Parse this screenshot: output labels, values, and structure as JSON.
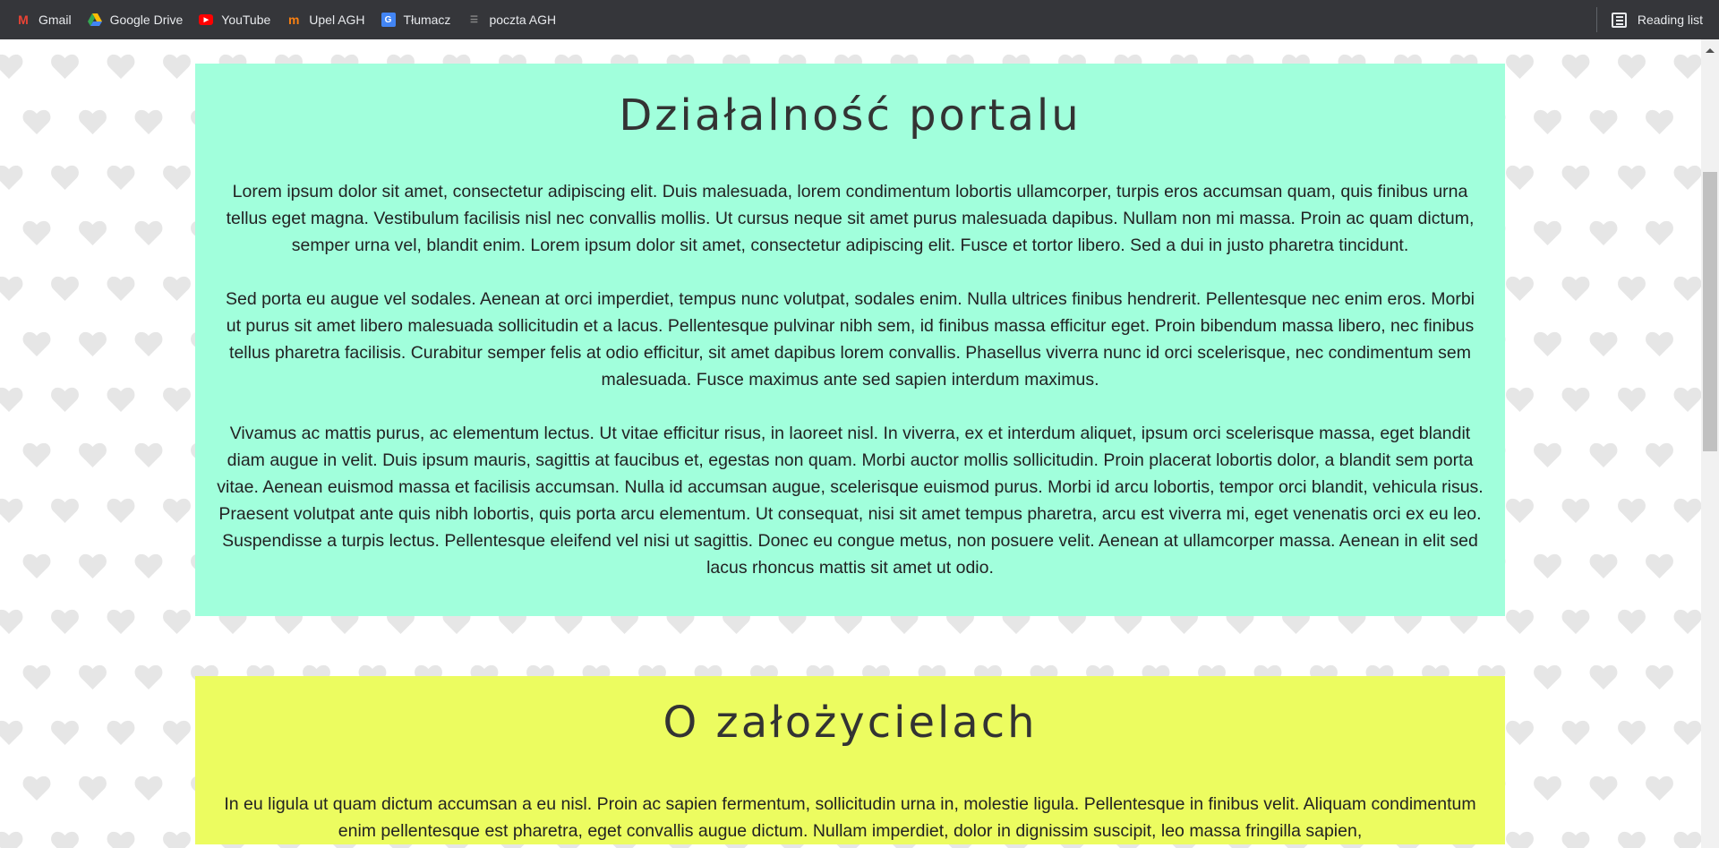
{
  "bookmarks": [
    {
      "label": "Gmail",
      "icon": "gmail-icon",
      "color": "#ea4335"
    },
    {
      "label": "Google Drive",
      "icon": "google-drive-icon",
      "color": "#34a853"
    },
    {
      "label": "YouTube",
      "icon": "youtube-icon",
      "color": "#ff0000"
    },
    {
      "label": "Upel AGH",
      "icon": "moodle-icon",
      "color": "#f98012"
    },
    {
      "label": "Tłumacz",
      "icon": "google-translate-icon",
      "color": "#4285f4"
    },
    {
      "label": "poczta AGH",
      "icon": "mail-icon",
      "color": "#444444"
    }
  ],
  "reading_list": "Reading list",
  "sections": [
    {
      "title": "Działalność portalu",
      "bg": "#a1ffdc",
      "paragraphs": [
        "Lorem ipsum dolor sit amet, consectetur adipiscing elit. Duis malesuada, lorem condimentum lobortis ullamcorper, turpis eros accumsan quam, quis finibus urna tellus eget magna. Vestibulum facilisis nisl nec convallis mollis. Ut cursus neque sit amet purus malesuada dapibus. Nullam non mi massa. Proin ac quam dictum, semper urna vel, blandit enim. Lorem ipsum dolor sit amet, consectetur adipiscing elit. Fusce et tortor libero. Sed a dui in justo pharetra tincidunt.",
        "Sed porta eu augue vel sodales. Aenean at orci imperdiet, tempus nunc volutpat, sodales enim. Nulla ultrices finibus hendrerit. Pellentesque nec enim eros. Morbi ut purus sit amet libero malesuada sollicitudin et a lacus. Pellentesque pulvinar nibh sem, id finibus massa efficitur eget. Proin bibendum massa libero, nec finibus tellus pharetra facilisis. Curabitur semper felis at odio efficitur, sit amet dapibus lorem convallis. Phasellus viverra nunc id orci scelerisque, nec condimentum sem malesuada. Fusce maximus ante sed sapien interdum maximus.",
        "Vivamus ac mattis purus, ac elementum lectus. Ut vitae efficitur risus, in laoreet nisl. In viverra, ex et interdum aliquet, ipsum orci scelerisque massa, eget blandit diam augue in velit. Duis ipsum mauris, sagittis at faucibus et, egestas non quam. Morbi auctor mollis sollicitudin. Proin placerat lobortis dolor, a blandit sem porta vitae. Aenean euismod massa et facilisis accumsan. Nulla id accumsan augue, scelerisque euismod purus. Morbi id arcu lobortis, tempor orci blandit, vehicula risus. Praesent volutpat ante quis nibh lobortis, quis porta arcu elementum. Ut consequat, nisi sit amet tempus pharetra, arcu est viverra mi, eget venenatis orci ex eu leo. Suspendisse a turpis lectus. Pellentesque eleifend vel nisi ut sagittis. Donec eu congue metus, non posuere velit. Aenean at ullamcorper massa. Aenean in elit sed lacus rhoncus mattis sit amet ut odio."
      ]
    },
    {
      "title": "O założycielach",
      "bg": "#ecfc60",
      "paragraphs": [
        "In eu ligula ut quam dictum accumsan a eu nisl. Proin ac sapien fermentum, sollicitudin urna in, molestie ligula. Pellentesque in finibus velit. Aliquam condimentum enim pellentesque est pharetra, eget convallis augue dictum. Nullam imperdiet, dolor in dignissim suscipit, leo massa fringilla sapien,"
      ]
    }
  ],
  "background_pattern": {
    "icon": "heart-icon",
    "color": "#e6e6e6"
  },
  "scroll": {
    "position_fraction": 0.12
  }
}
